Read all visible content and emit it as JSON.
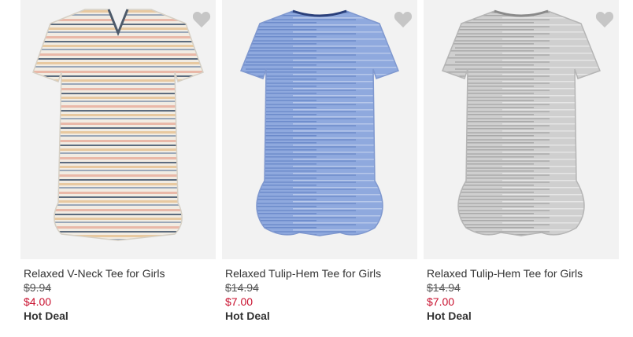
{
  "products": [
    {
      "name": "Relaxed V-Neck Tee for Girls",
      "original_price": "$9.94",
      "sale_price": "$4.00",
      "badge": "Hot Deal",
      "shirt_color": "#f1ece3",
      "icon": "heart-icon"
    },
    {
      "name": "Relaxed Tulip-Hem Tee for Girls",
      "original_price": "$14.94",
      "sale_price": "$7.00",
      "badge": "Hot Deal",
      "shirt_color": "#8fa9de",
      "icon": "heart-icon"
    },
    {
      "name": "Relaxed Tulip-Hem Tee for Girls",
      "original_price": "$14.94",
      "sale_price": "$7.00",
      "badge": "Hot Deal",
      "shirt_color": "#c9c9c9",
      "icon": "heart-icon"
    }
  ],
  "colors": {
    "sale": "#c8102e",
    "text": "#333333",
    "favorite_icon": "#c6c6c6"
  }
}
